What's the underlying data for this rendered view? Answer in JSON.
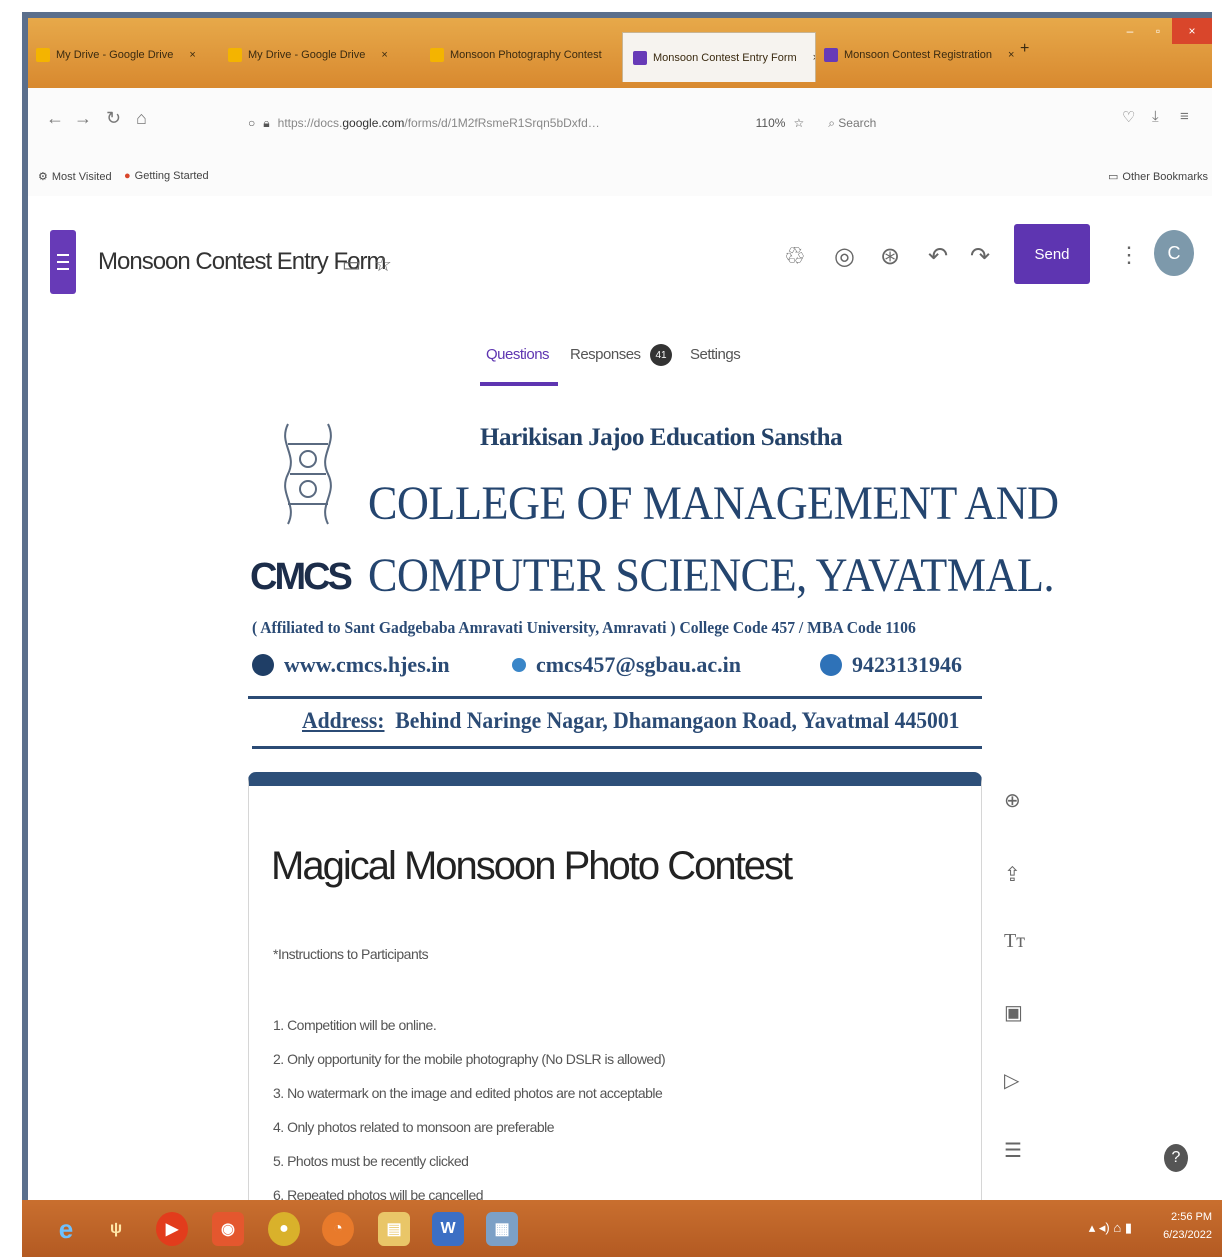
{
  "browser": {
    "tabs": [
      {
        "label": "My Drive - Google Drive",
        "close": "×",
        "color": "#f4b400"
      },
      {
        "label": "My Drive - Google Drive",
        "close": "×",
        "color": "#f4b400"
      },
      {
        "label": "Monsoon Photography Contest",
        "close": "×",
        "color": "#f4b400"
      },
      {
        "label": "Monsoon Contest Entry Form",
        "close": "×",
        "color": "#673ab7"
      },
      {
        "label": "Monsoon Contest Registration",
        "close": "×",
        "color": "#673ab7"
      }
    ],
    "new_tab": "+",
    "window_controls": {
      "minimize": "–",
      "maximize": "▫",
      "close": "×"
    },
    "url": {
      "prefix": "https://docs.",
      "domain": "google.com",
      "path": "/forms/d/1M2fRsmeR1Srqn5bDxfd…",
      "zoom": "110%"
    },
    "search_placeholder": "Search",
    "bookmarks": [
      {
        "label": "Most Visited"
      },
      {
        "label": "Getting Started"
      }
    ],
    "other_bookmarks": "Other Bookmarks"
  },
  "app": {
    "doc_title": "Monsoon Contest Entry Form",
    "send_label": "Send",
    "avatar_letter": "C",
    "tabs": {
      "questions": "Questions",
      "responses": "Responses",
      "responses_count": "41",
      "settings": "Settings"
    },
    "accent_color": "#5e35b1"
  },
  "header_image": {
    "logo_text": "CMCS",
    "sanstha": "Harikisan Jajoo Education Sanstha",
    "college_line1": "COLLEGE OF MANAGEMENT AND",
    "college_line2": "COMPUTER SCIENCE, YAVATMAL.",
    "affiliation": "( Affiliated to Sant Gadgebaba Amravati University, Amravati ) College Code 457 / MBA Code 1106",
    "website": "www.cmcs.hjes.in",
    "email": "cmcs457@sgbau.ac.in",
    "phone": "9423131946",
    "address_label": "Address:",
    "address_text": "Behind Naringe Nagar, Dhamangaon Road, Yavatmal 445001"
  },
  "form": {
    "title": "Magical Monsoon Photo Contest",
    "instructions_heading": "*Instructions to Participants",
    "instructions": [
      "1. Competition will be online.",
      "2. Only opportunity for the mobile photography (No DSLR is allowed)",
      "3. No watermark on the image and edited photos are not acceptable",
      "4. Only photos related to monsoon are preferable",
      "5. Photos must be recently clicked",
      "6. Repeated photos will be cancelled"
    ]
  },
  "taskbar": {
    "time": "2:56 PM",
    "date": "6/23/2022"
  }
}
